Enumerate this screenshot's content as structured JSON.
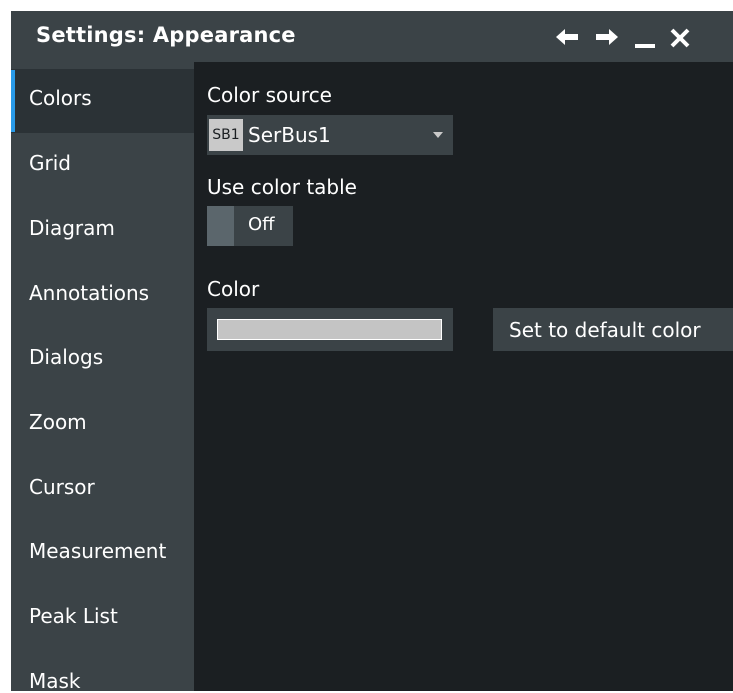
{
  "window": {
    "title": "Settings: Appearance",
    "buttons": [
      "back-icon",
      "forward-icon",
      "minimize-icon",
      "close-icon"
    ]
  },
  "sidebar": {
    "items": [
      {
        "label": "Colors",
        "active": true
      },
      {
        "label": "Grid"
      },
      {
        "label": "Diagram"
      },
      {
        "label": "Annotations"
      },
      {
        "label": "Dialogs"
      },
      {
        "label": "Zoom"
      },
      {
        "label": "Cursor"
      },
      {
        "label": "Measurement"
      },
      {
        "label": "Peak List"
      },
      {
        "label": "Mask"
      }
    ]
  },
  "main": {
    "color_source": {
      "label": "Color source",
      "badge": "SB1",
      "value": "SerBus1"
    },
    "use_color_table": {
      "label": "Use color table",
      "state": "Off"
    },
    "color": {
      "label": "Color",
      "swatch": "#c4c4c4"
    },
    "default_button": "Set to default color"
  },
  "colors": {
    "titlebar": "#3b4347",
    "background": "#1b1f22",
    "accent": "#2a9be8",
    "text": "#ffffff"
  }
}
